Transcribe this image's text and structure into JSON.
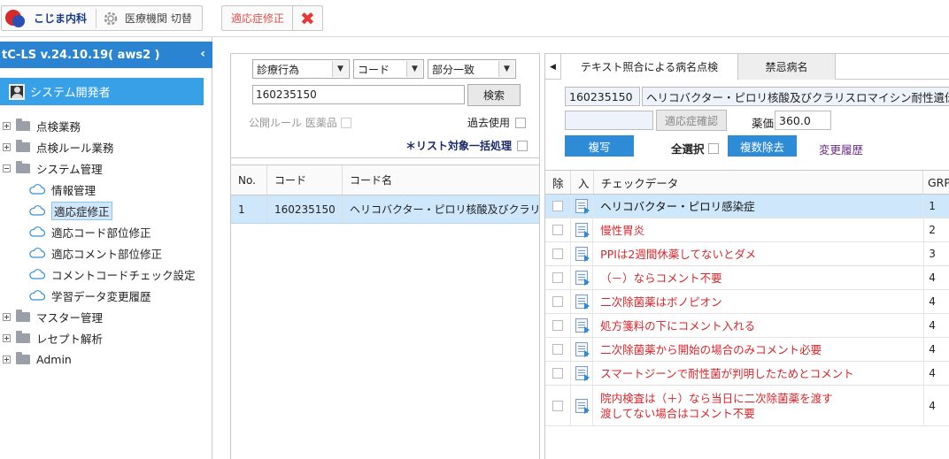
{
  "topbar": {
    "clinic_name": "こじま内科",
    "switch_label": "医療機関 切替",
    "tab_label": "適応症修正",
    "close_symbol": "✖"
  },
  "sidebar": {
    "version": "tC-LS v.24.10.19( aws2 )",
    "collapse_symbol": "‹",
    "user": "システム開発者",
    "tree": [
      {
        "label": "点検業務",
        "type": "folder",
        "expanded": false
      },
      {
        "label": "点検ルール業務",
        "type": "folder",
        "expanded": false
      },
      {
        "label": "システム管理",
        "type": "folder",
        "expanded": true
      },
      {
        "label": "情報管理",
        "type": "child"
      },
      {
        "label": "適応症修正",
        "type": "child",
        "selected": true
      },
      {
        "label": "適応コード部位修正",
        "type": "child"
      },
      {
        "label": "適応コメント部位修正",
        "type": "child"
      },
      {
        "label": "コメントコードチェック設定",
        "type": "child"
      },
      {
        "label": "学習データ変更履歴",
        "type": "child"
      },
      {
        "label": "マスター管理",
        "type": "folder",
        "expanded": false
      },
      {
        "label": "レセプト解析",
        "type": "folder",
        "expanded": false
      },
      {
        "label": "Admin",
        "type": "folder",
        "expanded": false
      }
    ]
  },
  "search": {
    "select1": "診療行為",
    "select2": "コード",
    "select3": "部分一致",
    "code_value": "160235150",
    "search_button": "検索",
    "public_rule": "公開ルール 医薬品",
    "past_use": "過去使用",
    "batch_process": "＊リスト対象一括処理",
    "dropdown_arrow": "▼"
  },
  "result_table": {
    "headers": [
      "No.",
      "コード",
      "コード名"
    ],
    "rows": [
      {
        "no": "1",
        "code": "160235150",
        "name": "ヘリコバクター・ピロリ核酸及びクラリスロマイシン耐性遺伝子"
      }
    ]
  },
  "right": {
    "tab_arrow": "◀",
    "tabs": [
      "テキスト照合による病名点検",
      "禁忌病名"
    ],
    "code": "160235150",
    "code_name": "ヘリコバクター・ピロリ核酸及びクラリスロマイシン耐性遺伝子",
    "confirm_button": "適応症確認",
    "price_label": "薬価",
    "price_value": "360.0",
    "copy_button": "複写",
    "select_all": "全選択",
    "multi_remove_button": "複数除去",
    "history_link": "変更履歴"
  },
  "check_table": {
    "headers": [
      "除",
      "入",
      "チェックデータ",
      "GRP"
    ],
    "rows": [
      {
        "text": "ヘリコバクター・ピロリ感染症",
        "grp": "1",
        "selected": true
      },
      {
        "text": "慢性胃炎",
        "grp": "2"
      },
      {
        "text": "PPIは2週間休薬してないとダメ",
        "grp": "3"
      },
      {
        "text": "（－）ならコメント不要",
        "grp": "4"
      },
      {
        "text": "二次除菌薬はボノピオン",
        "grp": "4"
      },
      {
        "text": "処方箋料の下にコメント入れる",
        "grp": "4"
      },
      {
        "text": "二次除菌薬から開始の場合のみコメント必要",
        "grp": "4"
      },
      {
        "text": "スマートジーンで耐性菌が判明したためとコメント",
        "grp": "4"
      },
      {
        "text": "院内検査は（＋）なら当日に二次除菌薬を渡す",
        "text2": "渡してない場合はコメント不要",
        "grp": "4"
      }
    ]
  }
}
